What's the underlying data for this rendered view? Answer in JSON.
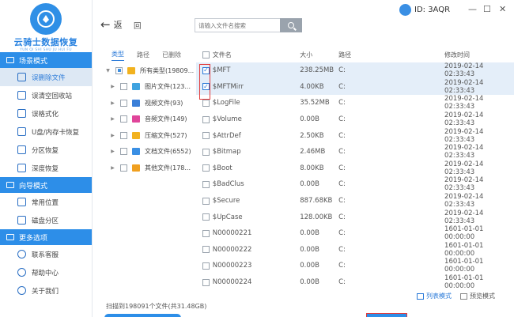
{
  "app": {
    "logo_title": "云骑士数据恢复",
    "logo_subtitle": "YUN QI SHI SHU JU HUI FU",
    "id_label": "ID: 3AQR"
  },
  "window_controls": {
    "minimize": "—",
    "maximize": "☐",
    "close": "✕"
  },
  "sidebar": {
    "sections": [
      {
        "title": "场景模式",
        "items": [
          "误删除文件",
          "误清空回收站",
          "误格式化",
          "U盘/内存卡恢复",
          "分区恢复",
          "深度恢复"
        ]
      },
      {
        "title": "向导模式",
        "items": [
          "常用位置",
          "磁盘分区"
        ]
      },
      {
        "title": "更多选项",
        "items": [
          "联系客服",
          "帮助中心",
          "关于我们"
        ]
      }
    ],
    "active_item": "误删除文件"
  },
  "toolbar": {
    "back_label": "返",
    "back_arrow": "←",
    "up_label": "回",
    "search_placeholder": "请输入文件名搜索"
  },
  "tree": {
    "tabs": [
      "类型",
      "路径",
      "已删除"
    ],
    "active_tab": "类型",
    "root": "所有类型(19809...",
    "children": [
      {
        "label": "图片文件(123...",
        "color": "#3fa3e0"
      },
      {
        "label": "视频文件(93)",
        "color": "#3a7fd8"
      },
      {
        "label": "音频文件(149)",
        "color": "#e0459a"
      },
      {
        "label": "压缩文件(527)",
        "color": "#f2b21f"
      },
      {
        "label": "文档文件(6552)",
        "color": "#3a8fe4"
      },
      {
        "label": "其他文件(178...",
        "color": "#f0a020"
      }
    ]
  },
  "file_list": {
    "columns": [
      "文件名",
      "大小",
      "路径",
      "修改时间"
    ],
    "rows": [
      {
        "name": "$MFT",
        "size": "238.25MB",
        "path": "C:",
        "modified": "2019-02-14 02:33:43",
        "checked": true
      },
      {
        "name": "$MFTMirr",
        "size": "4.00KB",
        "path": "C:",
        "modified": "2019-02-14 02:33:43",
        "checked": true
      },
      {
        "name": "$LogFile",
        "size": "35.52MB",
        "path": "C:",
        "modified": "2019-02-14 02:33:43",
        "checked": false
      },
      {
        "name": "$Volume",
        "size": "0.00B",
        "path": "C:",
        "modified": "2019-02-14 02:33:43",
        "checked": false
      },
      {
        "name": "$AttrDef",
        "size": "2.50KB",
        "path": "C:",
        "modified": "2019-02-14 02:33:43",
        "checked": false
      },
      {
        "name": "$Bitmap",
        "size": "2.46MB",
        "path": "C:",
        "modified": "2019-02-14 02:33:43",
        "checked": false
      },
      {
        "name": "$Boot",
        "size": "8.00KB",
        "path": "C:",
        "modified": "2019-02-14 02:33:43",
        "checked": false
      },
      {
        "name": "$BadClus",
        "size": "0.00B",
        "path": "C:",
        "modified": "2019-02-14 02:33:43",
        "checked": false
      },
      {
        "name": "$Secure",
        "size": "887.68KB",
        "path": "C:",
        "modified": "2019-02-14 02:33:43",
        "checked": false
      },
      {
        "name": "$UpCase",
        "size": "128.00KB",
        "path": "C:",
        "modified": "2019-02-14 02:33:43",
        "checked": false
      },
      {
        "name": "N00000221",
        "size": "0.00B",
        "path": "C:",
        "modified": "1601-01-01 00:00:00",
        "checked": false
      },
      {
        "name": "N00000222",
        "size": "0.00B",
        "path": "C:",
        "modified": "1601-01-01 00:00:00",
        "checked": false
      },
      {
        "name": "N00000223",
        "size": "0.00B",
        "path": "C:",
        "modified": "1601-01-01 00:00:00",
        "checked": false
      },
      {
        "name": "N00000224",
        "size": "0.00B",
        "path": "C:",
        "modified": "1601-01-01 00:00:00",
        "checked": false
      }
    ]
  },
  "status": {
    "scanned": "扫描到198091个文件(共31.48GB)",
    "list_mode": "列表模式",
    "preview_mode": "预览模式"
  },
  "colors": {
    "accent": "#2d8ee8",
    "highlight": "#e4eef9",
    "mark": "#e23a3a"
  }
}
